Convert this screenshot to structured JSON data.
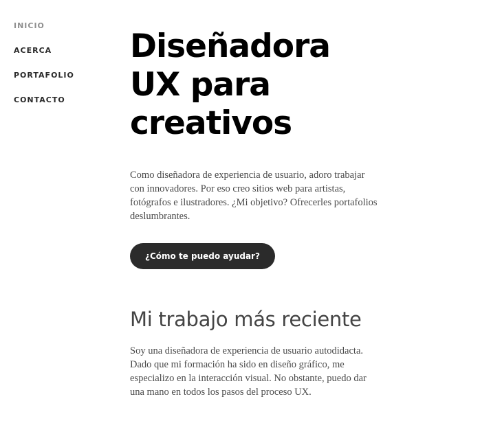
{
  "nav": {
    "items": [
      {
        "label": "INICIO",
        "active": true
      },
      {
        "label": "ACERCA",
        "active": false
      },
      {
        "label": "PORTAFOLIO",
        "active": false
      },
      {
        "label": "CONTACTO",
        "active": false
      }
    ]
  },
  "hero": {
    "title_lines": [
      "Diseñadora",
      "UX para",
      "creativos"
    ],
    "text": "Como diseñadora de experiencia de usuario, adoro trabajar con innovadores. Por eso creo sitios web para artistas, fotógrafos e ilustradores. ¿Mi objetivo? Ofrecerles portafolios deslumbrantes.",
    "cta_label": "¿Cómo te puedo ayudar?"
  },
  "recent_work": {
    "title": "Mi trabajo más reciente",
    "text": "Soy una diseñadora de experiencia de usuario autodidacta. Dado que mi formación ha sido en diseño gráfico, me especializo en la interacción visual. No obstante, puedo dar una mano en todos los pasos del proceso UX."
  },
  "colors": {
    "nav_active": "#8e8e8e",
    "nav_default": "#2a2a2a",
    "button_bg": "#2b2b2b",
    "title": "#000000",
    "section_title": "#444444",
    "body_text": "#4a4a4a"
  }
}
